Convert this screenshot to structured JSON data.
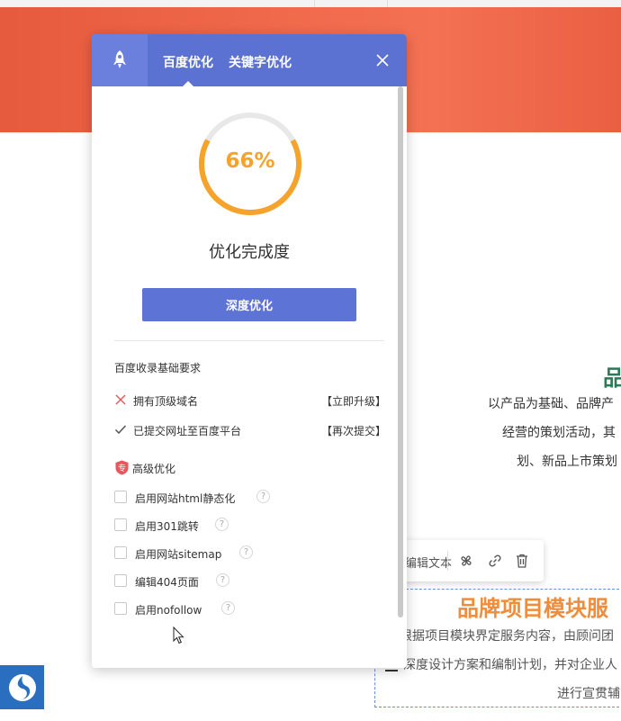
{
  "colors": {
    "accent": "#5c72d3",
    "progress": "#f6a32b",
    "hero": "#f0694b",
    "success_green": "#2a7a57",
    "title_orange": "#f08c3a"
  },
  "panel": {
    "tabs": [
      {
        "label": "百度优化",
        "active": true
      },
      {
        "label": "关键字优化",
        "active": false
      }
    ],
    "progress": {
      "percent_label": "66%",
      "value": 0.66,
      "caption": "优化完成度"
    },
    "deep_button": "深度优化",
    "section_title": "百度收录基础要求",
    "requirements": [
      {
        "status": "fail",
        "icon": "cross-icon",
        "label": "拥有顶级域名",
        "action": "【立即升级】"
      },
      {
        "status": "pass",
        "icon": "check-icon",
        "label": "已提交网址至百度平台",
        "action": "【再次提交】"
      }
    ],
    "advanced": {
      "badge": "专",
      "title": "高级优化"
    },
    "options": [
      {
        "label": "启用网站html静态化",
        "checked": false,
        "help": "?"
      },
      {
        "label": "启用301跳转",
        "checked": false,
        "help": "?"
      },
      {
        "label": "启用网站sitemap",
        "checked": false,
        "help": "?"
      },
      {
        "label": "编辑404页面",
        "checked": false,
        "help": "?"
      },
      {
        "label": "启用nofollow",
        "checked": false,
        "help": "?"
      }
    ]
  },
  "background": {
    "heading": "品",
    "lines": [
      "以产品为基础、品牌产",
      "经营的策划活动，其",
      "划、新品上市策划"
    ],
    "toolbar": {
      "label": "编辑文本",
      "tools": [
        "fan-icon",
        "link-icon",
        "trash-icon"
      ]
    },
    "box": {
      "title": "品牌项目模块服",
      "lines": [
        "根据项目模块界定服务内容，由顾问团",
        "深度设计方案和编制计划，并对企业人",
        "进行宣贯辅"
      ]
    }
  }
}
